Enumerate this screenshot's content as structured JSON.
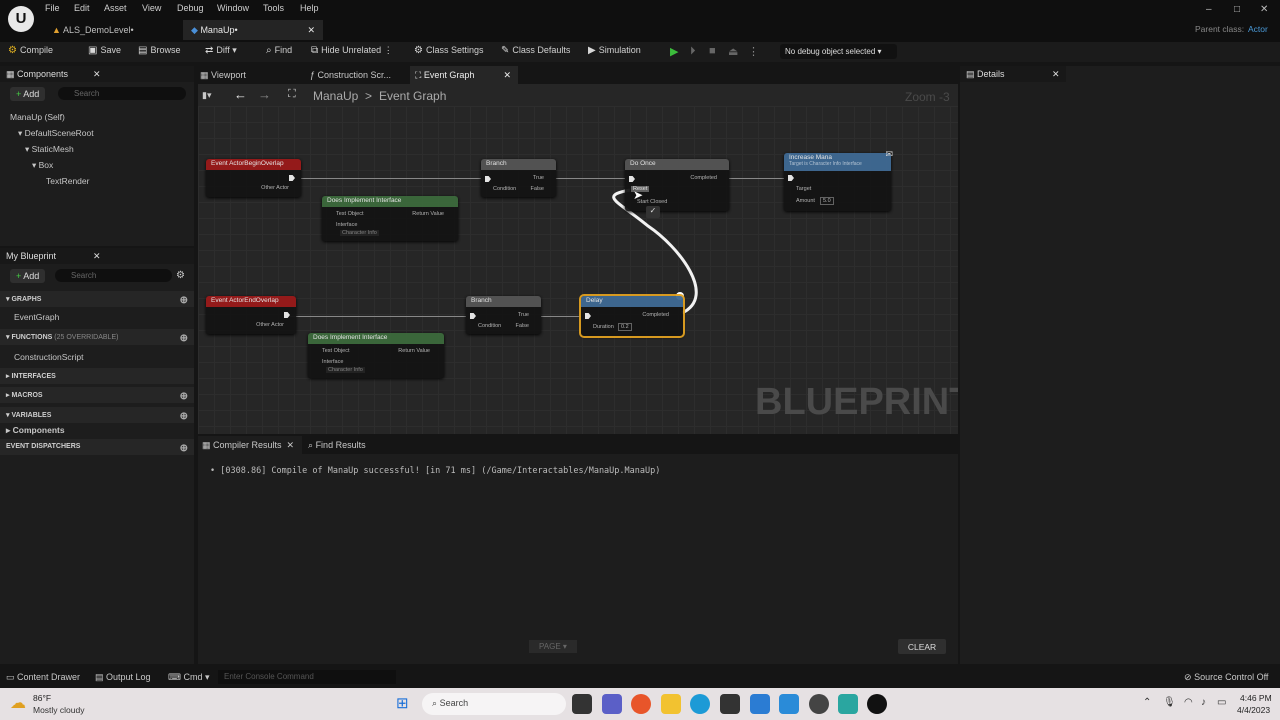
{
  "menu": [
    "File",
    "Edit",
    "Asset",
    "View",
    "Debug",
    "Window",
    "Tools",
    "Help"
  ],
  "tabs": [
    {
      "label": "ALS_DemoLevel•"
    },
    {
      "label": "ManaUp•"
    }
  ],
  "window_controls": {
    "minimize": "–",
    "maximize": "□",
    "close": "✕"
  },
  "parent_class": {
    "label": "Parent class:",
    "value": "Actor"
  },
  "toolbar": {
    "compile": "Compile",
    "save": "Save",
    "browse": "Browse",
    "diff": "Diff",
    "find": "Find",
    "hide_unrelated": "Hide Unrelated",
    "class_settings": "Class Settings",
    "class_defaults": "Class Defaults",
    "simulation": "Simulation",
    "debug_object": "No debug object selected"
  },
  "components_panel": {
    "title": "Components",
    "add": "Add",
    "search_placeholder": "Search",
    "tree": [
      "ManaUp (Self)",
      "DefaultSceneRoot",
      "StaticMesh",
      "Box",
      "TextRender"
    ]
  },
  "my_blueprint": {
    "title": "My Blueprint",
    "add": "Add",
    "search_placeholder": "Search",
    "graphs": "GRAPHS",
    "event_graph": "EventGraph",
    "functions": "FUNCTIONS",
    "overridable": "(25 OVERRIDABLE)",
    "construction_script": "ConstructionScript",
    "interfaces": "INTERFACES",
    "macros": "MACROS",
    "variables": "VARIABLES",
    "components": "Components",
    "event_dispatchers": "EVENT DISPATCHERS"
  },
  "graph_tabs": {
    "viewport": "Viewport",
    "construction": "Construction Scr...",
    "event_graph": "Event Graph"
  },
  "breadcrumb": {
    "root": "ManaUp",
    "sep": ">",
    "current": "Event Graph"
  },
  "zoom": "Zoom -3",
  "watermark": "BLUEPRINT",
  "nodes": {
    "begin_overlap": {
      "title": "Event ActorBeginOverlap",
      "pin": "Other Actor"
    },
    "end_overlap": {
      "title": "Event ActorEndOverlap",
      "pin": "Other Actor"
    },
    "does_impl": {
      "title": "Does Implement Interface",
      "test": "Test Object",
      "ret": "Return Value",
      "iface": "Interface",
      "iface_val": "Character Info"
    },
    "branch": {
      "title": "Branch",
      "cond": "Condition",
      "t": "True",
      "f": "False"
    },
    "do_once": {
      "title": "Do Once",
      "completed": "Completed",
      "reset": "Reset",
      "start_closed": "Start Closed"
    },
    "increase_mana": {
      "title": "Increase Mana",
      "sub": "Target is Character Info Interface",
      "target": "Target",
      "amount": "Amount",
      "amount_val": "5.0"
    },
    "delay": {
      "title": "Delay",
      "completed": "Completed",
      "duration": "Duration",
      "duration_val": "0.2"
    }
  },
  "details": {
    "title": "Details"
  },
  "bottom": {
    "compiler_results": "Compiler Results",
    "find_results": "Find Results",
    "log": "[0308.86] Compile of ManaUp successful! [in 71 ms] (/Game/Interactables/ManaUp.ManaUp)",
    "page": "PAGE",
    "clear": "CLEAR"
  },
  "statusbar": {
    "content_drawer": "Content Drawer",
    "output_log": "Output Log",
    "cmd": "Cmd",
    "console_placeholder": "Enter Console Command",
    "source_control": "Source Control Off"
  },
  "taskbar": {
    "temp": "86°F",
    "weather": "Mostly cloudy",
    "search": "Search",
    "time": "4:46 PM",
    "date": "4/4/2023"
  }
}
